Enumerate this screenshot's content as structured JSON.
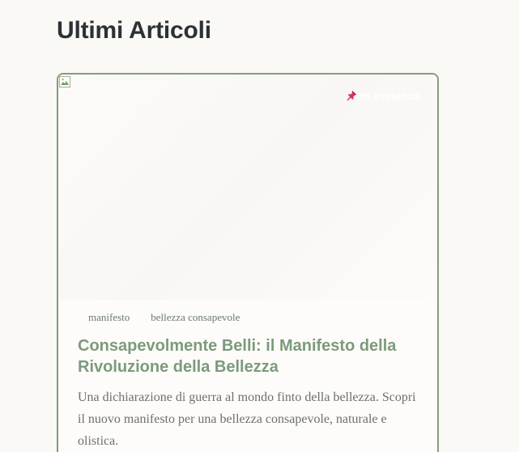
{
  "section": {
    "title": "Ultimi Articoli"
  },
  "article": {
    "featured_label": "In evidenza",
    "tags": [
      "manifesto",
      "bellezza consapevole"
    ],
    "title": "Consapevolmente Belli: il Manifesto della Rivoluzione della Bellezza",
    "excerpt": "Una dichiarazione di guerra al mondo finto della bellezza. Scopri il nuovo manifesto per una bellezza consapevole, naturale e olistica."
  },
  "colors": {
    "accent": "#7c9a7c",
    "card_border": "#7f9e7f",
    "heading": "#2c3136",
    "background": "#fbf9f5",
    "pin": "#d6336c"
  }
}
